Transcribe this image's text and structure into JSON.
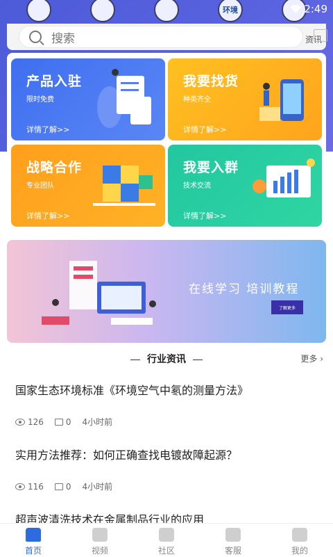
{
  "status_bar": {
    "time": "2:49"
  },
  "top_icons": [
    {
      "name": "profile-circle-icon",
      "label": ""
    },
    {
      "name": "swap-circle-icon",
      "label": ""
    },
    {
      "name": "wechat-circle-icon",
      "label": ""
    },
    {
      "name": "environment-circle-icon",
      "label": "环境"
    },
    {
      "name": "news-circle-icon",
      "label": ""
    }
  ],
  "search": {
    "placeholder": "搜索",
    "extra": "资讯"
  },
  "cards": [
    {
      "title": "产品入驻",
      "subtitle": "限时免费",
      "more": "详情了解>>"
    },
    {
      "title": "我要找货",
      "subtitle": "种类齐全",
      "more": "详情了解>>"
    },
    {
      "title": "战略合作",
      "subtitle": "专业团队",
      "more": "详情了解>>"
    },
    {
      "title": "我要入群",
      "subtitle": "技术交流",
      "more": "详情了解>>"
    }
  ],
  "banner": {
    "title": "在线学习  培训教程",
    "button": "了解更多"
  },
  "section": {
    "title": "行业资讯",
    "more": "更多"
  },
  "news": [
    {
      "title": "国家生态环境标准《环境空气中氡的测量方法》",
      "views": "126",
      "comments": "0",
      "time": "4小时前"
    },
    {
      "title": "实用方法推荐：如何正确查找电镀故障起源？",
      "views": "116",
      "comments": "0",
      "time": "4小时前"
    },
    {
      "title": "超声波清洗技术在金属制品行业的应用"
    }
  ],
  "tabs": [
    {
      "label": "首页"
    },
    {
      "label": "视频"
    },
    {
      "label": "社区"
    },
    {
      "label": "客服"
    },
    {
      "label": "我的"
    }
  ]
}
